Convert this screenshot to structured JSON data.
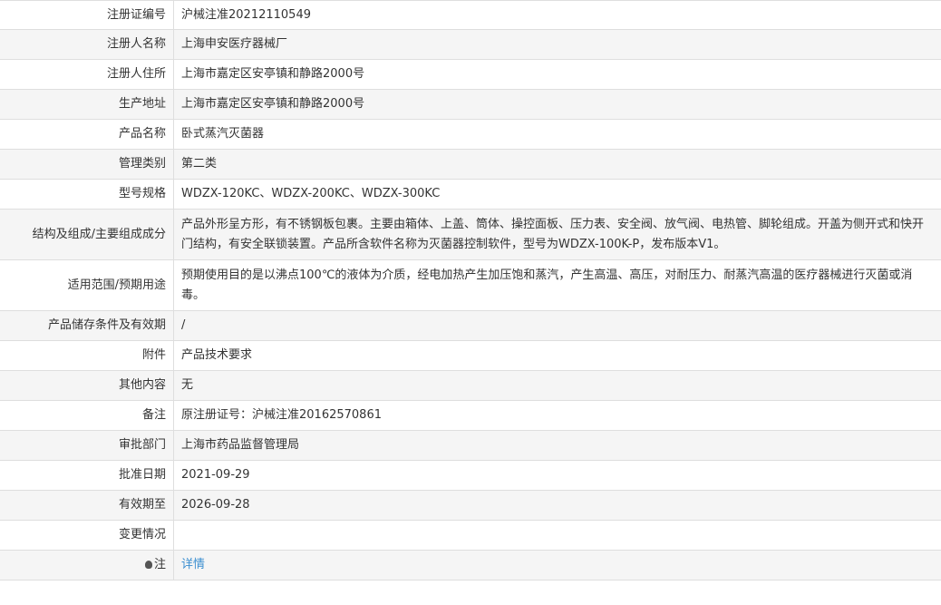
{
  "rows": [
    {
      "label": "注册证编号",
      "value": "沪械注准20212110549"
    },
    {
      "label": "注册人名称",
      "value": "上海申安医疗器械厂"
    },
    {
      "label": "注册人住所",
      "value": "上海市嘉定区安亭镇和静路2000号"
    },
    {
      "label": "生产地址",
      "value": "上海市嘉定区安亭镇和静路2000号"
    },
    {
      "label": "产品名称",
      "value": "卧式蒸汽灭菌器"
    },
    {
      "label": "管理类别",
      "value": "第二类"
    },
    {
      "label": "型号规格",
      "value": "WDZX-120KC、WDZX-200KC、WDZX-300KC"
    },
    {
      "label": "结构及组成/主要组成成分",
      "value": "产品外形呈方形，有不锈钢板包裹。主要由箱体、上盖、筒体、操控面板、压力表、安全阀、放气阀、电热管、脚轮组成。开盖为侧开式和快开门结构，有安全联锁装置。产品所含软件名称为灭菌器控制软件，型号为WDZX-100K-P，发布版本V1。"
    },
    {
      "label": "适用范围/预期用途",
      "value": "预期使用目的是以沸点100℃的液体为介质，经电加热产生加压饱和蒸汽，产生高温、高压，对耐压力、耐蒸汽高温的医疗器械进行灭菌或消毒。"
    },
    {
      "label": "产品储存条件及有效期",
      "value": "/"
    },
    {
      "label": "附件",
      "value": "产品技术要求"
    },
    {
      "label": "其他内容",
      "value": "无"
    },
    {
      "label": "备注",
      "value": "原注册证号：沪械注准20162570861"
    },
    {
      "label": "审批部门",
      "value": "上海市药品监督管理局"
    },
    {
      "label": "批准日期",
      "value": "2021-09-29"
    },
    {
      "label": "有效期至",
      "value": "2026-09-28"
    },
    {
      "label": "变更情况",
      "value": ""
    }
  ],
  "note": {
    "label": "注",
    "link_text": "详情",
    "icon": "lightbulb-icon"
  }
}
